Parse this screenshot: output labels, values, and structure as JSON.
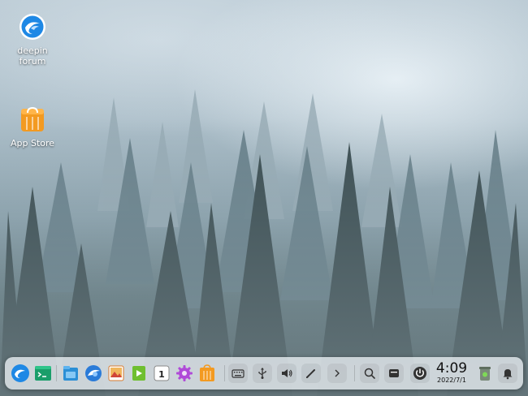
{
  "desktop": {
    "icons": [
      {
        "label_line1": "deepin",
        "label_line2": "forum",
        "icon": "deepin-forum-icon"
      },
      {
        "label_line1": "App Store",
        "icon": "app-store-icon"
      }
    ]
  },
  "dock": {
    "apps": [
      {
        "name": "launcher",
        "icon": "deepin-launcher-icon"
      },
      {
        "name": "terminal",
        "icon": "terminal-icon"
      },
      {
        "name": "file-manager",
        "icon": "file-manager-icon"
      },
      {
        "name": "browser",
        "icon": "browser-icon"
      },
      {
        "name": "image-viewer",
        "icon": "image-viewer-icon"
      },
      {
        "name": "video-player",
        "icon": "video-player-icon"
      },
      {
        "name": "calendar",
        "icon": "calendar-icon",
        "text": "1"
      },
      {
        "name": "control-center",
        "icon": "gear-icon"
      },
      {
        "name": "app-store",
        "icon": "app-store-icon"
      }
    ],
    "tray": [
      {
        "name": "keyboard",
        "icon": "keyboard-icon"
      },
      {
        "name": "usb",
        "icon": "usb-icon"
      },
      {
        "name": "volume",
        "icon": "volume-icon"
      },
      {
        "name": "pen",
        "icon": "pen-icon"
      },
      {
        "name": "expand",
        "icon": "chevron-right-icon"
      },
      {
        "name": "search",
        "icon": "search-icon"
      },
      {
        "name": "multitasking",
        "icon": "multitask-icon"
      },
      {
        "name": "power",
        "icon": "power-icon"
      },
      {
        "name": "trash",
        "icon": "trash-icon"
      },
      {
        "name": "notification",
        "icon": "bell-icon"
      }
    ],
    "clock": {
      "time": "4:09",
      "date": "2022/7/1"
    }
  },
  "colors": {
    "deepin_blue": "#1e88e5",
    "store_orange": "#f39a21",
    "dock_bg": "#ebf0f3"
  }
}
